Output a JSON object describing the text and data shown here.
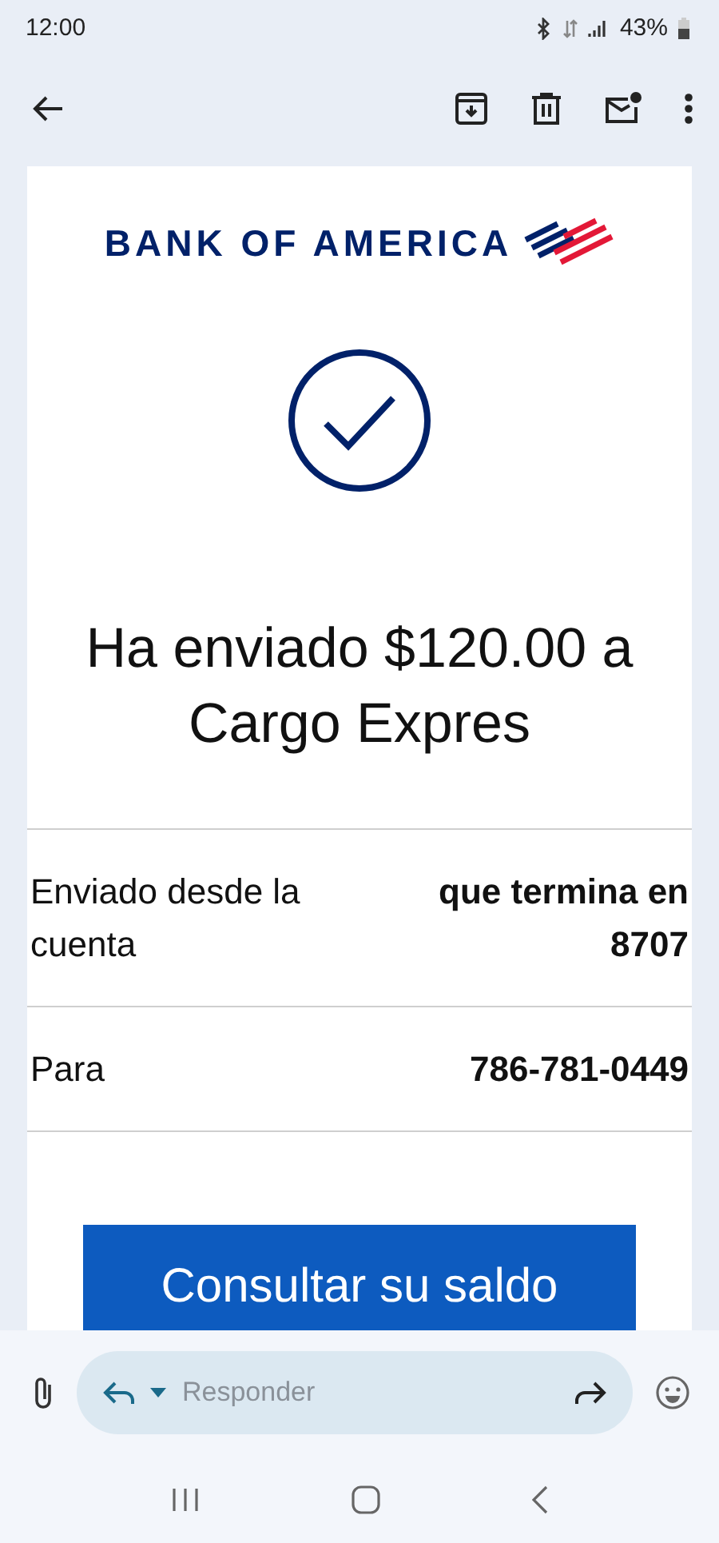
{
  "status_bar": {
    "time": "12:00",
    "battery": "43%"
  },
  "email": {
    "brand": "BANK OF AMERICA",
    "heading": "Ha enviado $120.00 a Cargo Expres",
    "details": [
      {
        "label": "Enviado desde la cuenta",
        "value": "que termina en 8707"
      },
      {
        "label": "Para",
        "value": "786-781-0449"
      }
    ],
    "button": "Consultar su saldo"
  },
  "reply": {
    "placeholder": "Responder"
  }
}
